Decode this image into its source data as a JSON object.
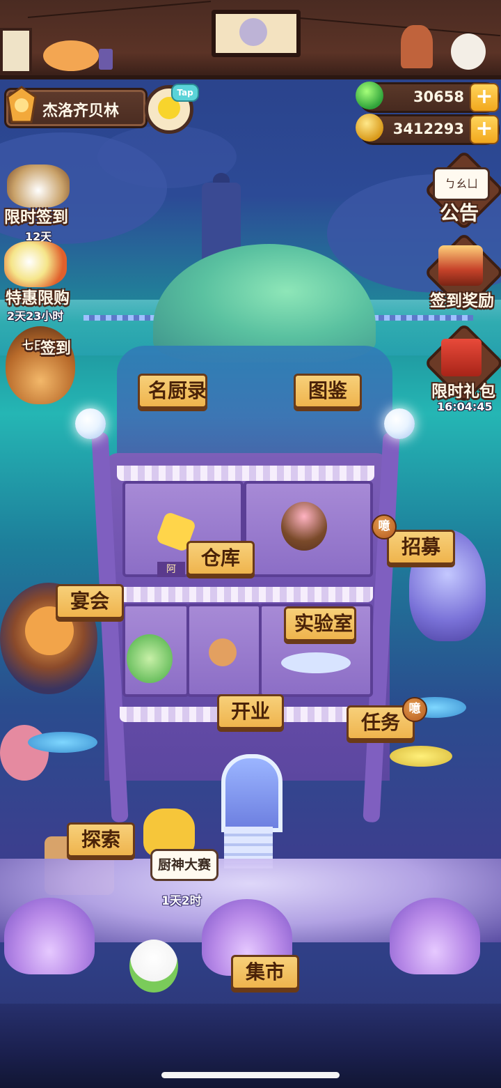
{
  "player": {
    "name": "杰洛齐贝林",
    "tap_label": "Tap"
  },
  "currencies": [
    {
      "icon": "green-gem-icon",
      "value": "30658",
      "plus": "+"
    },
    {
      "icon": "gold-coin-icon",
      "value": "3412293",
      "plus": "+"
    }
  ],
  "left_sidebar": [
    {
      "label": "限时签到",
      "sub": "12天",
      "icon": "rice-bowl-icon"
    },
    {
      "label": "特惠限购",
      "sub": "2天23小时",
      "icon": "gift-star-icon"
    },
    {
      "label": "七日签到",
      "icon_text": "七日",
      "icon_text2": "签到",
      "icon": "hotpot-icon"
    }
  ],
  "right_sidebar": [
    {
      "label": "公告",
      "icon_text": "ㄅㄠㄩ",
      "icon": "notice-icon"
    },
    {
      "label": "签到奖励",
      "icon": "cake-icon"
    },
    {
      "label": "限时礼包",
      "sub": "16:04:45",
      "icon": "gift-box-icon"
    }
  ],
  "buildings": {
    "chefs": "名厨录",
    "catalog": "图鉴",
    "warehouse": "仓库",
    "recruit": "招募",
    "banquet": "宴会",
    "lab": "实验室",
    "open": "开业",
    "tasks": "任务",
    "explore": "探索",
    "market": "集市"
  },
  "badges": {
    "recruit_badge": "噫",
    "tasks_badge": "噫"
  },
  "shop_sign": "阿",
  "event": {
    "name": "厨神大赛",
    "timer": "1天2时"
  },
  "colors": {
    "sign_fill": "#efb44d",
    "wood": "#4a2c21",
    "sea": "#25b6b4"
  }
}
